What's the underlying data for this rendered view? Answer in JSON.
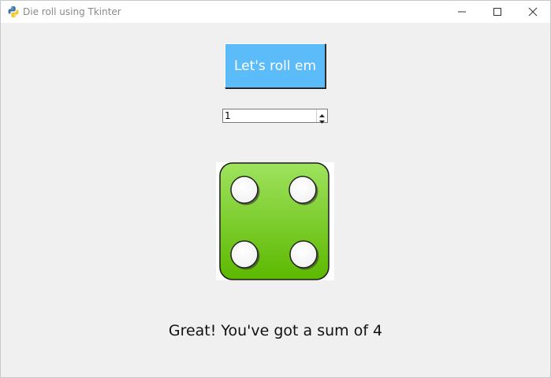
{
  "window": {
    "title": "Die roll using Tkinter",
    "icons": {
      "app": "python-icon",
      "minimize": "minimize-icon",
      "maximize": "maximize-icon",
      "close": "close-icon"
    }
  },
  "controls": {
    "roll_button_label": "Let's roll em",
    "dice_count_value": "1"
  },
  "die": {
    "face_value": 4,
    "color": "#7fd43a",
    "pip_color": "#ffffff"
  },
  "result": {
    "message": "Great! You've got a sum of 4"
  },
  "colors": {
    "button_bg": "#5cbcfa",
    "window_bg": "#f0f0f0"
  }
}
